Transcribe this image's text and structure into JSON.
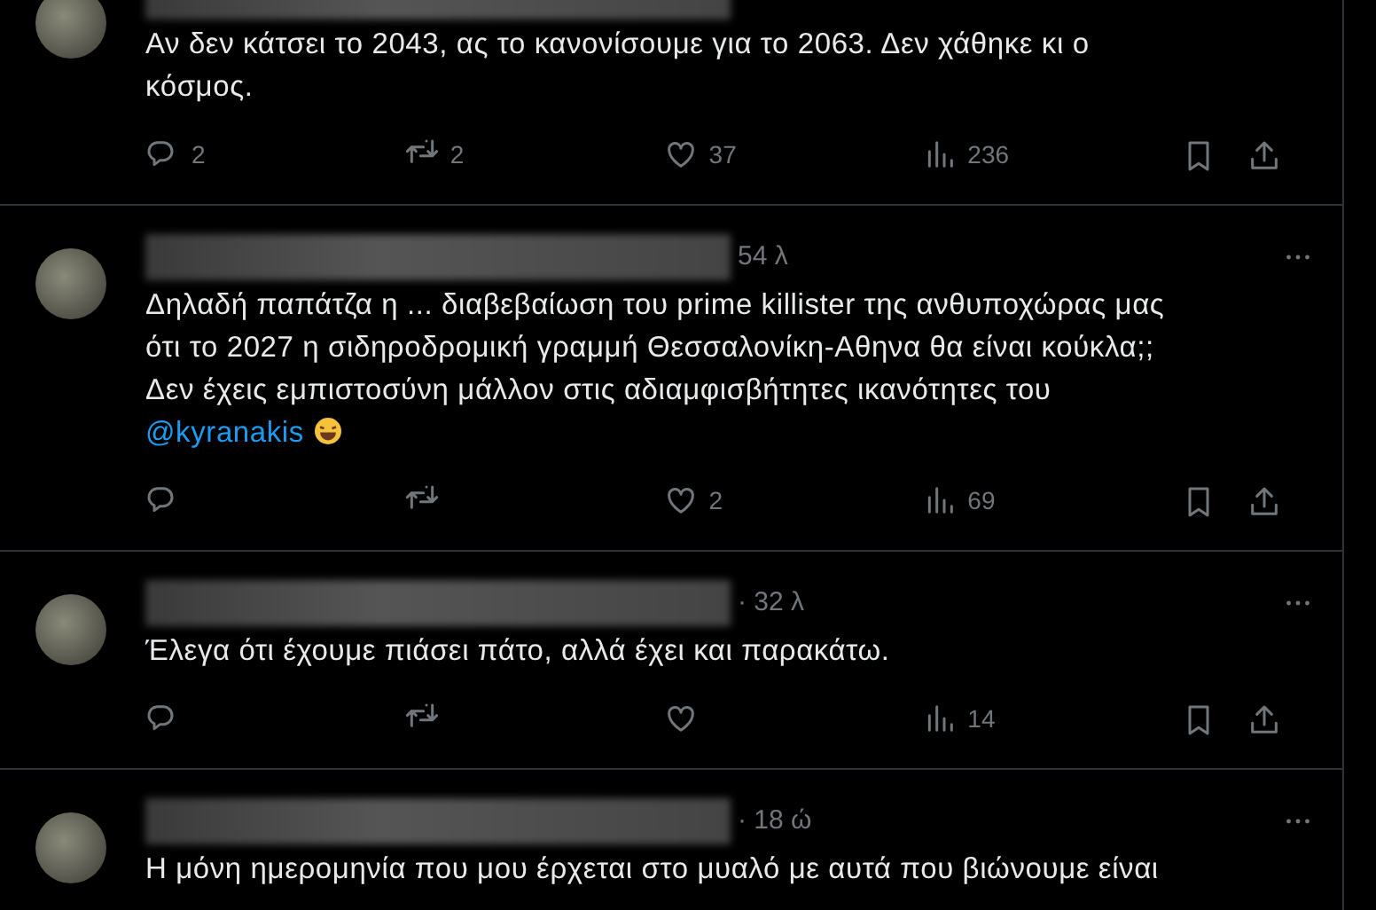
{
  "tweets": [
    {
      "text": "Αν δεν κάτσει το 2043, ας το κανονίσουμε για το 2063. Δεν χάθηκε κι ο κόσμος.",
      "replies": "2",
      "retweets": "2",
      "likes": "37",
      "views": "236"
    },
    {
      "time": "54 λ",
      "text": "Δηλαδή παπάτζα η ... διαβεβαίωση του prime killister της ανθυποχώρας μας ότι το 2027 η σιδηροδρομική γραμμή Θεσσαλονίκη-Αθηνα θα είναι κούκλα;; Δεν έχεις εμπιστοσύνη μάλλον στις αδιαμφισβήτητες ικανότητες του",
      "mention": "@kyranakis",
      "laughing_emoji": true,
      "likes": "2",
      "views": "69"
    },
    {
      "time": "· 32 λ",
      "text": "Έλεγα ότι έχουμε πιάσει πάτο, αλλά έχει και παρακάτω.",
      "views": "14"
    },
    {
      "time": "· 18 ώ",
      "text": "Η μόνη ημερομηνία που μου έρχεται στο μυαλό με αυτά που βιώνουμε είναι"
    }
  ]
}
